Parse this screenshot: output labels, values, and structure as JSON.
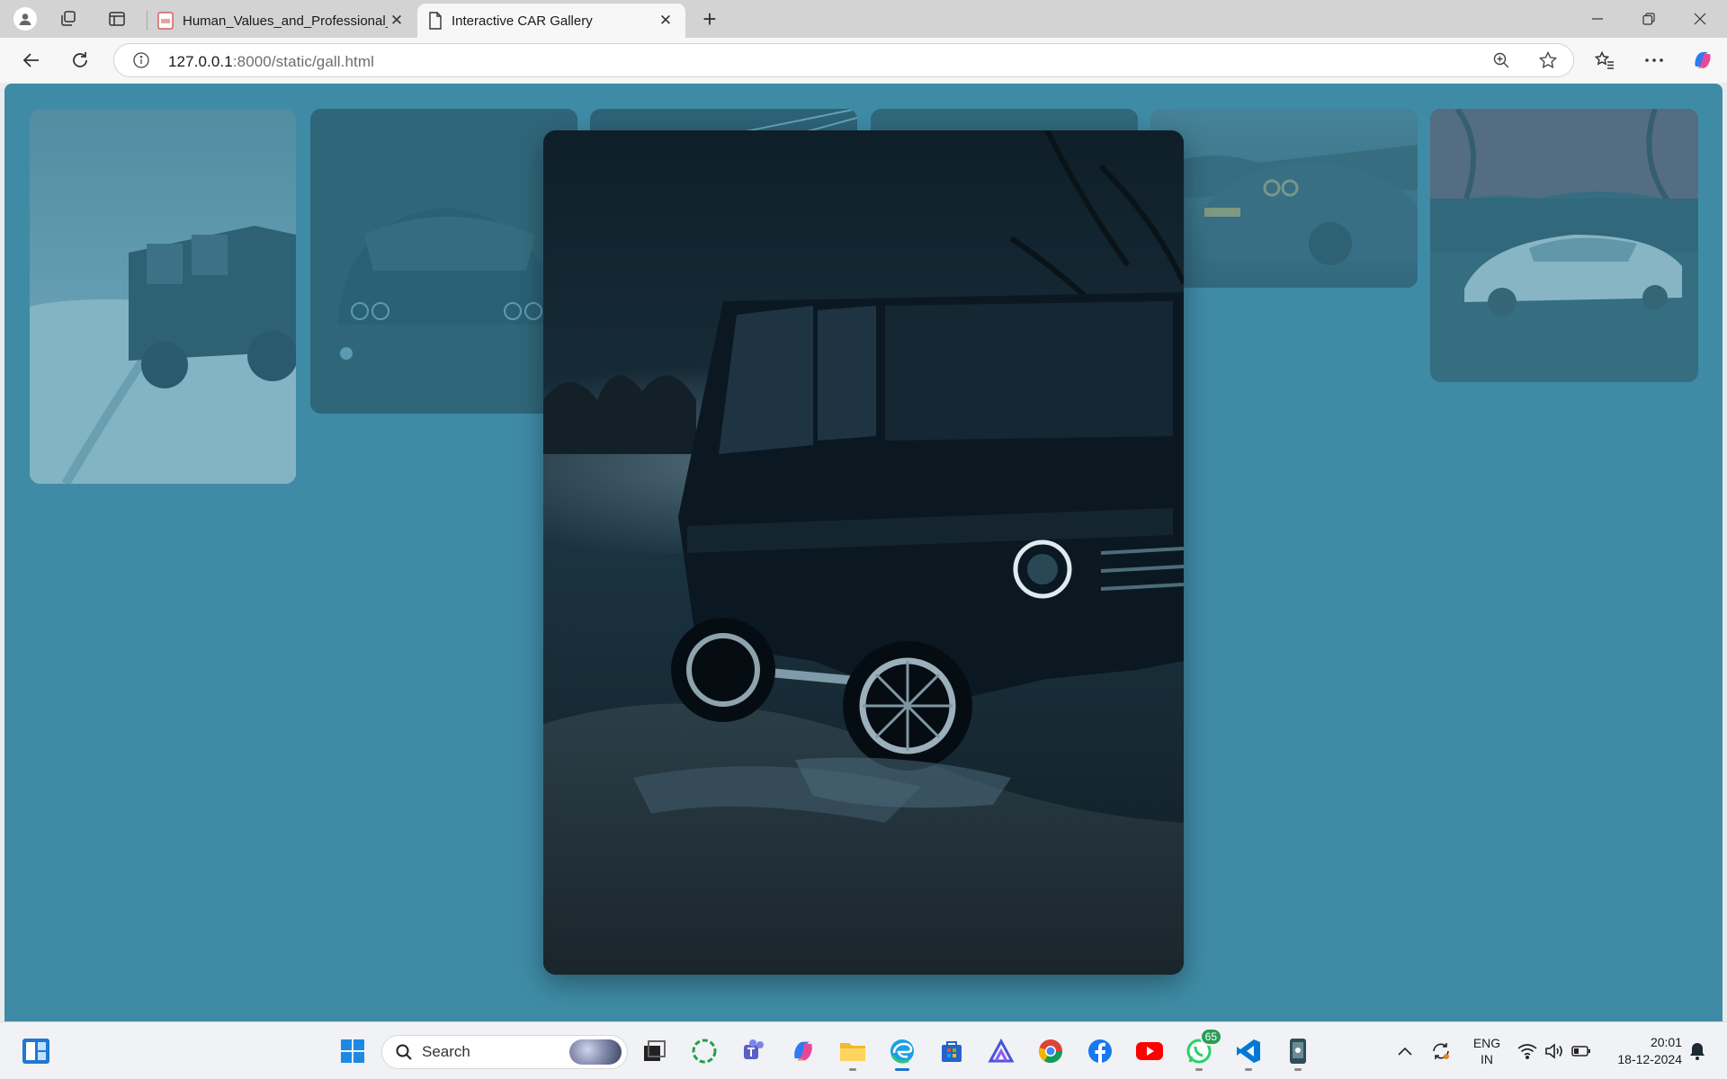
{
  "browser": {
    "tabs": [
      {
        "title": "Human_Values_and_Professional_",
        "icon": "pdf-icon",
        "active": false
      },
      {
        "title": "Interactive CAR Gallery",
        "icon": "page-icon",
        "active": true
      }
    ],
    "address": {
      "host": "127.0.0.1",
      "path": ":8000/static/gall.html"
    }
  },
  "gallery": {
    "background_color": "#3f8ba6",
    "thumbnails": [
      {
        "subject": "suv-on-snow"
      },
      {
        "subject": "car-rear-lights"
      },
      {
        "subject": "car-light-trails"
      },
      {
        "subject": "car-dark"
      },
      {
        "subject": "gtr-at-night"
      },
      {
        "subject": "white-supra"
      }
    ],
    "lightbox": {
      "subject": "black-g-wagon-offroad"
    }
  },
  "taskbar": {
    "search_label": "Search",
    "apps": [
      "widgets-icon",
      "start-icon",
      "task-view-icon",
      "loader-app-icon",
      "teams-icon",
      "copilot-icon",
      "file-explorer-icon",
      "edge-icon",
      "store-icon",
      "app-icon",
      "chrome-icon",
      "facebook-icon",
      "youtube-icon",
      "whatsapp-icon",
      "vscode-icon",
      "device-app-icon"
    ],
    "whatsapp_badge": "65",
    "language": {
      "line1": "ENG",
      "line2": "IN"
    },
    "time": "20:01",
    "date": "18-12-2024"
  }
}
